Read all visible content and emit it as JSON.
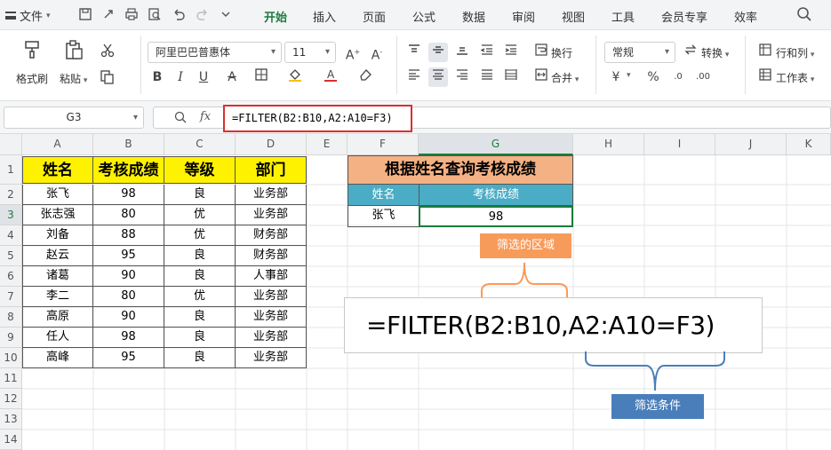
{
  "menu": {
    "file_label": "文件",
    "tabs": [
      "开始",
      "插入",
      "页面",
      "公式",
      "数据",
      "审阅",
      "视图",
      "工具",
      "会员专享",
      "效率"
    ],
    "active_tab": "开始"
  },
  "ribbon": {
    "format_painter": "格式刷",
    "paste": "粘贴",
    "font_name": "阿里巴巴普惠体",
    "font_size": "11",
    "wrap": "换行",
    "merge": "合并",
    "number_format": "常规",
    "convert": "转换",
    "row_col": "行和列",
    "worksheet": "工作表",
    "currency": "¥",
    "percent": "%"
  },
  "formula_bar": {
    "cell_ref": "G3",
    "fx": "fx",
    "formula": "=FILTER(B2:B10,A2:A10=F3)"
  },
  "columns": [
    "A",
    "B",
    "C",
    "D",
    "E",
    "F",
    "G",
    "H",
    "I",
    "J",
    "K"
  ],
  "rows": [
    "1",
    "2",
    "3",
    "4",
    "5",
    "6",
    "7",
    "8",
    "9",
    "10",
    "11",
    "12",
    "13",
    "14"
  ],
  "table": {
    "headers": [
      "姓名",
      "考核成绩",
      "等级",
      "部门"
    ],
    "rows": [
      [
        "张飞",
        "98",
        "良",
        "业务部"
      ],
      [
        "张志强",
        "80",
        "优",
        "业务部"
      ],
      [
        "刘备",
        "88",
        "优",
        "财务部"
      ],
      [
        "赵云",
        "95",
        "良",
        "财务部"
      ],
      [
        "诸葛",
        "90",
        "良",
        "人事部"
      ],
      [
        "李二",
        "80",
        "优",
        "业务部"
      ],
      [
        "高原",
        "90",
        "良",
        "业务部"
      ],
      [
        "任人",
        "98",
        "良",
        "业务部"
      ],
      [
        "高峰",
        "95",
        "良",
        "业务部"
      ]
    ]
  },
  "lookup": {
    "title": "根据姓名查询考核成绩",
    "name_header": "姓名",
    "score_header": "考核成绩",
    "name_value": "张飞",
    "score_value": "98"
  },
  "annotations": {
    "filter_range_label": "筛选的区域",
    "filter_condition_label": "筛选条件",
    "formula_display": "=FILTER(B2:B10,A2:A10=F3)"
  },
  "colors": {
    "accent_green": "#1b7c3c",
    "header_yellow": "#fff200",
    "title_orange": "#f4b183",
    "subheader_teal": "#4bacc6",
    "tag_orange": "#f79b5b",
    "tag_blue": "#4a7ebb",
    "highlight_red": "#d9302e"
  }
}
